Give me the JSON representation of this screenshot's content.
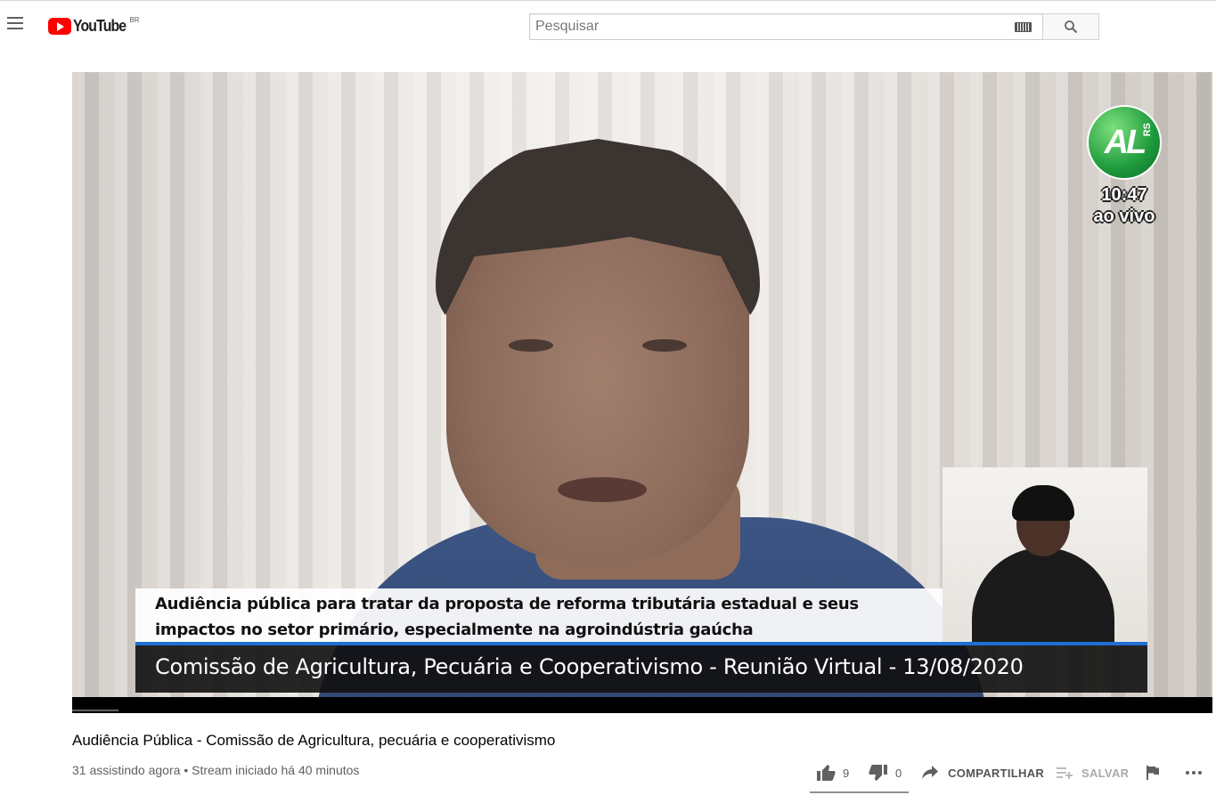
{
  "header": {
    "logo_text": "YouTube",
    "country_code": "BR",
    "search_placeholder": "Pesquisar"
  },
  "player": {
    "channel_logo_text": "AL",
    "channel_logo_region": "RS",
    "live_time": "10:47",
    "live_label": "ao vivo",
    "lower_third": {
      "headline_line1": "Audiência pública para tratar da proposta de reforma tributária estadual e seus",
      "headline_line2": "impactos no setor primário, especialmente na agroindústria gaúcha",
      "program": "Comissão de Agricultura, Pecuária e Cooperativismo - Reunião Virtual - 13/08/2020"
    },
    "accent_color": "#1f6fd4"
  },
  "video": {
    "title": "Audiência Pública - Comissão de Agricultura, pecuária e cooperativismo",
    "viewers": "31 assistindo agora",
    "separator": "•",
    "stream_info": "Stream iniciado há 40 minutos"
  },
  "actions": {
    "likes": "9",
    "dislikes": "0",
    "share_label": "COMPARTILHAR",
    "save_label": "SALVAR"
  }
}
